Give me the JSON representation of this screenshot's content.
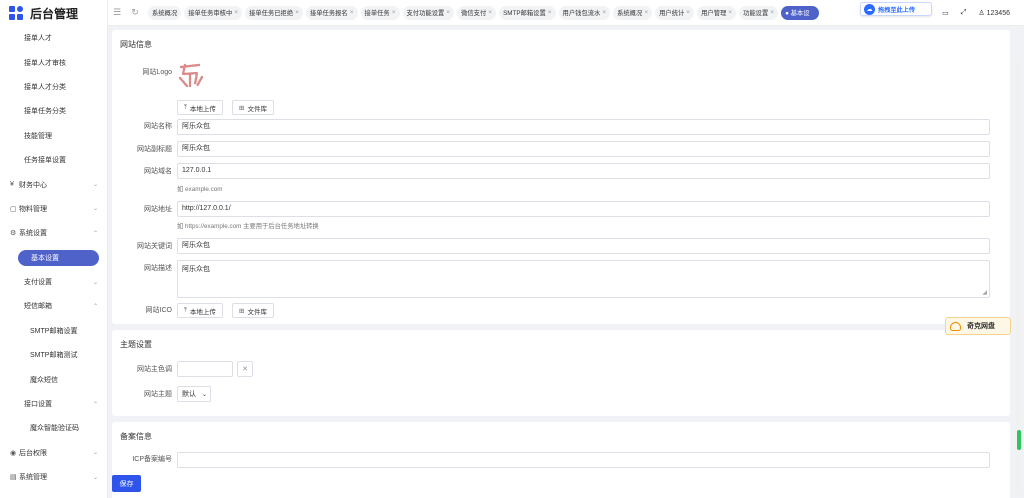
{
  "brand": {
    "title": "后台管理"
  },
  "sidebar": {
    "items": [
      {
        "label": "接单人才",
        "level": 2
      },
      {
        "label": "接单人才审核",
        "level": 2
      },
      {
        "label": "接单人才分类",
        "level": 2
      },
      {
        "label": "接单任务分类",
        "level": 2
      },
      {
        "label": "技能管理",
        "level": 2
      },
      {
        "label": "任务接单设置",
        "level": 2
      },
      {
        "label": "财务中心",
        "level": 1,
        "lead": "¥",
        "arrow": "⌄"
      },
      {
        "label": "物料管理",
        "level": 1,
        "lead": "▢",
        "arrow": "⌄"
      },
      {
        "label": "系统设置",
        "level": 1,
        "lead": "⚙",
        "arrow": "⌃"
      },
      {
        "label": "基本设置",
        "level": 2,
        "active": true
      },
      {
        "label": "支付设置",
        "level": 2,
        "arrow": "⌄"
      },
      {
        "label": "短信邮箱",
        "level": 2,
        "arrow": "⌃"
      },
      {
        "label": "SMTP邮箱设置",
        "level": 3
      },
      {
        "label": "SMTP邮箱测试",
        "level": 3
      },
      {
        "label": "魔众短信",
        "level": 3
      },
      {
        "label": "接口设置",
        "level": 2,
        "arrow": "⌃"
      },
      {
        "label": "魔众智能验证码",
        "level": 3
      },
      {
        "label": "后台权限",
        "level": 1,
        "lead": "◉",
        "arrow": "⌄"
      },
      {
        "label": "系统管理",
        "level": 1,
        "lead": "▤",
        "arrow": "⌄"
      }
    ]
  },
  "topbar": {
    "tabs": [
      {
        "label": "系统概况"
      },
      {
        "label": "接单任务审核中",
        "close": "×"
      },
      {
        "label": "接单任务已拒绝",
        "close": "×"
      },
      {
        "label": "接单任务报名",
        "close": "×"
      },
      {
        "label": "接单任务",
        "close": "×"
      },
      {
        "label": "支付功能设置",
        "close": "×"
      },
      {
        "label": "微信支付",
        "close": "×"
      },
      {
        "label": "SMTP邮箱设置",
        "close": "×"
      },
      {
        "label": "用户钱包流水",
        "close": "×"
      },
      {
        "label": "系统概况",
        "close": "×"
      },
      {
        "label": "用户统计",
        "close": "×"
      },
      {
        "label": "用户管理",
        "close": "×"
      },
      {
        "label": "功能设置",
        "close": "×"
      },
      {
        "label": "● 基本设",
        "active": true
      }
    ],
    "upload_chip": "拖拽至此上传",
    "user": "♙ 123456"
  },
  "site_info": {
    "title": "网站信息",
    "logo_label": "网站Logo",
    "local_upload": "本地上传",
    "library": "文件库",
    "name_label": "网站名称",
    "name_value": "阿乐众包",
    "subtitle_label": "网站副标题",
    "subtitle_value": "阿乐众包",
    "domain_label": "网站域名",
    "domain_value": "127.0.0.1",
    "domain_hint": "如 example.com",
    "address_label": "网站地址",
    "address_value": "http://127.0.0.1/",
    "address_hint": "如 https://example.com 主要用于后台任务地址转换",
    "keywords_label": "网站关键词",
    "keywords_value": "阿乐众包",
    "desc_label": "网站描述",
    "desc_value": "阿乐众包",
    "ico_label": "网站ICO"
  },
  "theme": {
    "title": "主题设置",
    "color_label": "网站主色调",
    "theme_label": "网站主题",
    "theme_value": "默认"
  },
  "beian": {
    "title": "备案信息",
    "icp_label": "ICP备案编号"
  },
  "footer": {
    "save": "保存"
  },
  "float_pan": "奇克网盘"
}
